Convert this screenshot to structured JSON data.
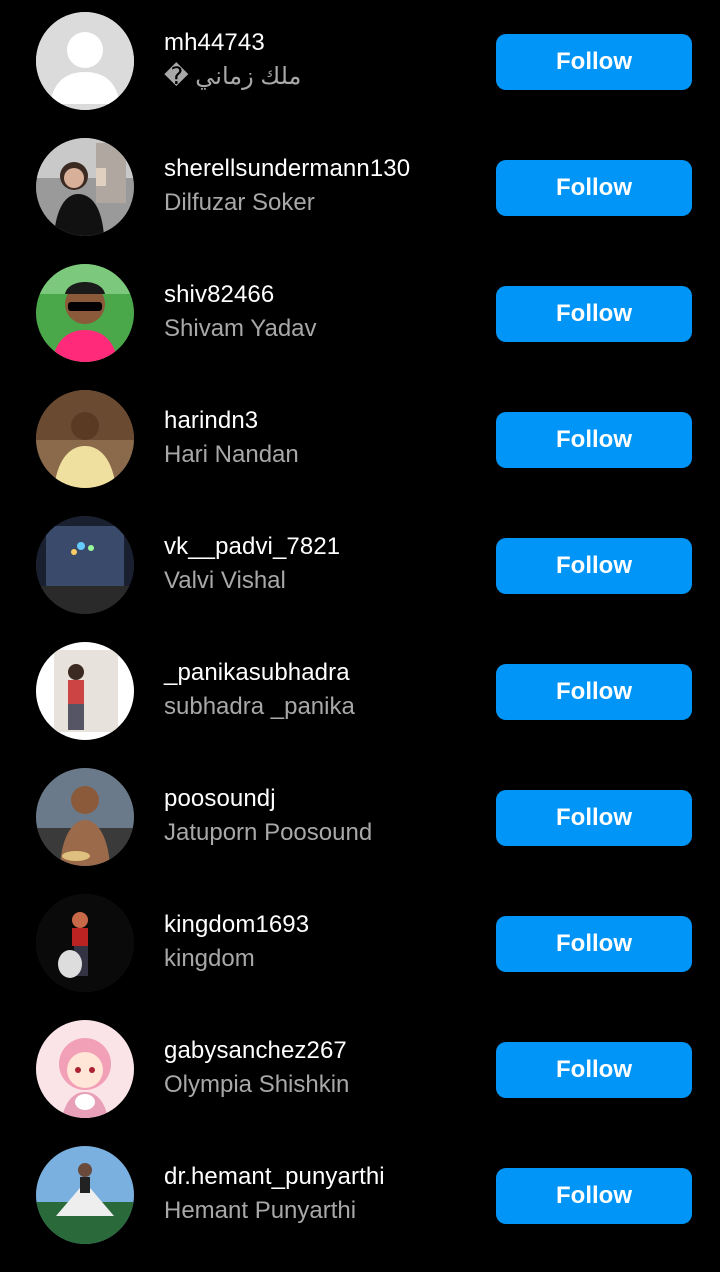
{
  "follow_label": "Follow",
  "accent_color": "#0095f6",
  "users": [
    {
      "username": "mh44743",
      "full_name": "ملك زماني �",
      "avatar": "default-avatar"
    },
    {
      "username": "sherellsundermann130",
      "full_name": "Dilfuzar Soker",
      "avatar": "photo"
    },
    {
      "username": "shiv82466",
      "full_name": "Shivam Yadav",
      "avatar": "photo"
    },
    {
      "username": "harindn3",
      "full_name": "Hari Nandan",
      "avatar": "photo"
    },
    {
      "username": "vk__padvi_7821",
      "full_name": "Valvi Vishal",
      "avatar": "photo"
    },
    {
      "username": "_panikasubhadra",
      "full_name": "subhadra _panika",
      "avatar": "photo"
    },
    {
      "username": "poosoundj",
      "full_name": "Jatuporn Poosound",
      "avatar": "photo"
    },
    {
      "username": "kingdom1693",
      "full_name": "kingdom",
      "avatar": "photo"
    },
    {
      "username": "gabysanchez267",
      "full_name": "Olympia Shishkin",
      "avatar": "photo"
    },
    {
      "username": "dr.hemant_punyarthi",
      "full_name": "Hemant Punyarthi",
      "avatar": "photo"
    }
  ]
}
